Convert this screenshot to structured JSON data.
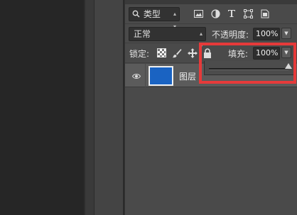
{
  "filter": {
    "kind_label": "类型",
    "icons": [
      "image-filter-icon",
      "adjustment-filter-icon",
      "text-filter-icon",
      "shape-filter-icon",
      "smart-object-filter-icon"
    ]
  },
  "blend": {
    "mode": "正常",
    "opacity_label": "不透明度:",
    "opacity_value": "100%"
  },
  "lock": {
    "label": "锁定:",
    "fill_label": "填充:",
    "fill_value": "100%",
    "fill_slider_value": 1.0
  },
  "layers": [
    {
      "name": "图层",
      "visible": true,
      "thumb_color": "#1a63c2"
    }
  ],
  "colors": {
    "highlight": "#e63a3a",
    "panel_bg": "#4a4a4a",
    "selected_row": "#5b5b5b"
  }
}
